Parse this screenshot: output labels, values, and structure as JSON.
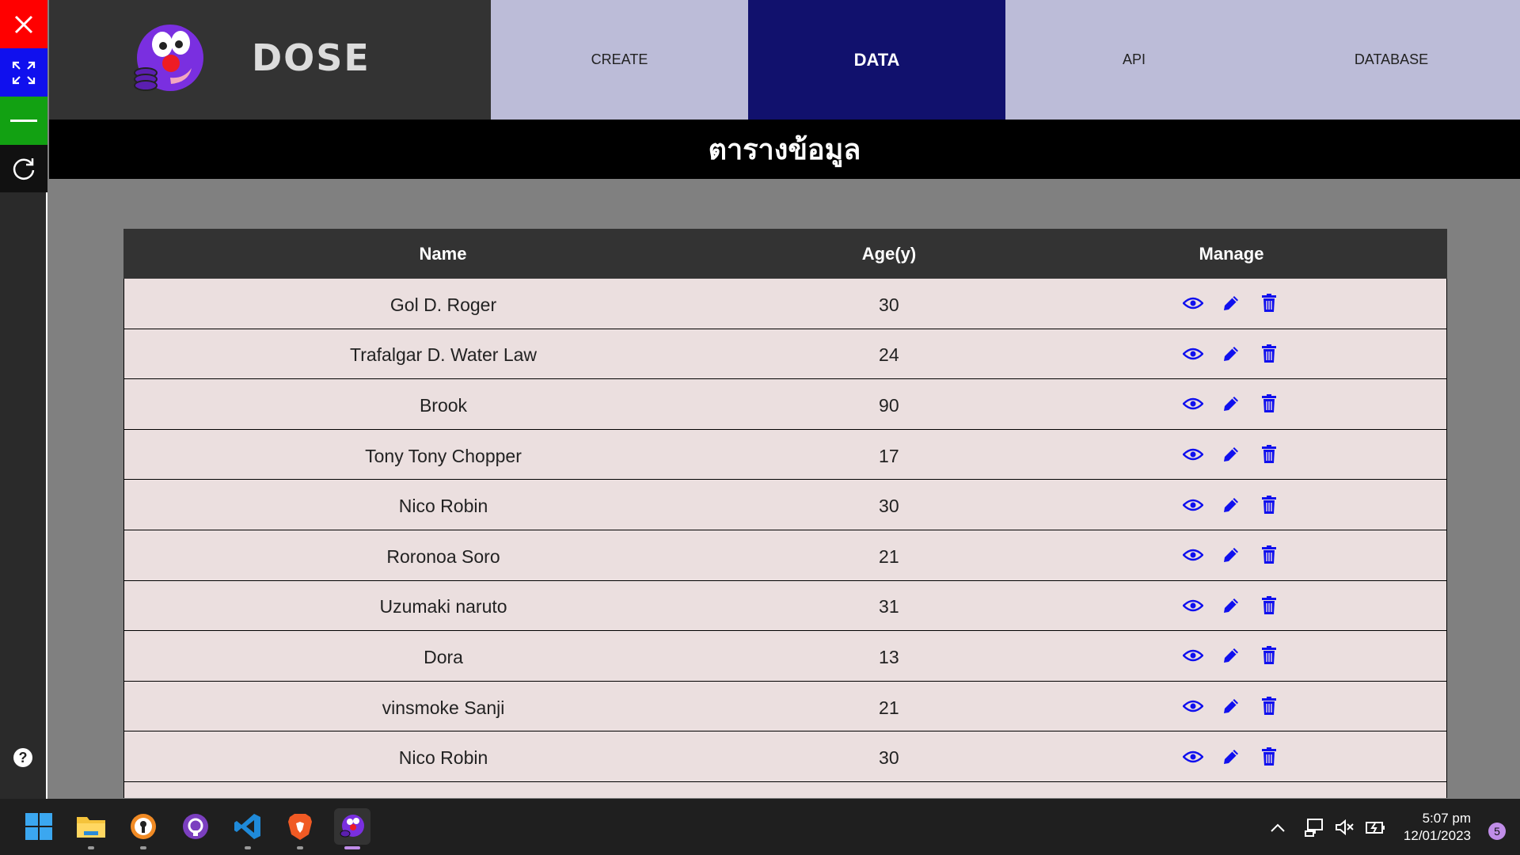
{
  "app": {
    "brand": "DOSE",
    "nav": [
      {
        "label": "CREATE",
        "active": false
      },
      {
        "label": "DATA",
        "active": true
      },
      {
        "label": "API",
        "active": false
      },
      {
        "label": "DATABASE",
        "active": false
      }
    ],
    "page_title": "ตารางข้อมูล"
  },
  "sidebar": {
    "buttons": [
      "close-icon",
      "expand-icon",
      "minimize-icon",
      "reload-icon"
    ],
    "help": "?"
  },
  "table": {
    "headers": [
      "Name",
      "Age(y)",
      "Manage"
    ],
    "rows": [
      {
        "name": "Gol D. Roger",
        "age": "30"
      },
      {
        "name": "Trafalgar D. Water Law",
        "age": "24"
      },
      {
        "name": "Brook",
        "age": "90"
      },
      {
        "name": "Tony Tony Chopper",
        "age": "17"
      },
      {
        "name": "Nico Robin",
        "age": "30"
      },
      {
        "name": "Roronoa Soro",
        "age": "21"
      },
      {
        "name": "Uzumaki naruto",
        "age": "31"
      },
      {
        "name": "Dora",
        "age": "13"
      },
      {
        "name": "vinsmoke Sanji",
        "age": "21"
      },
      {
        "name": "Nico Robin",
        "age": "30"
      }
    ],
    "action_icons": [
      "eye-icon",
      "pencil-icon",
      "trash-icon"
    ]
  },
  "taskbar": {
    "apps": [
      "windows-start-icon",
      "file-explorer-icon",
      "keyhole-app-icon",
      "github-icon",
      "vscode-icon",
      "brave-icon",
      "dose-app-icon"
    ],
    "time": "5:07 pm",
    "date": "12/01/2023",
    "notifications": "5"
  },
  "colors": {
    "accent_active": "#11116d",
    "nav_bg": "#bcbcd8",
    "row_bg": "#ebdfdf",
    "icon_blue": "#1010ee"
  }
}
